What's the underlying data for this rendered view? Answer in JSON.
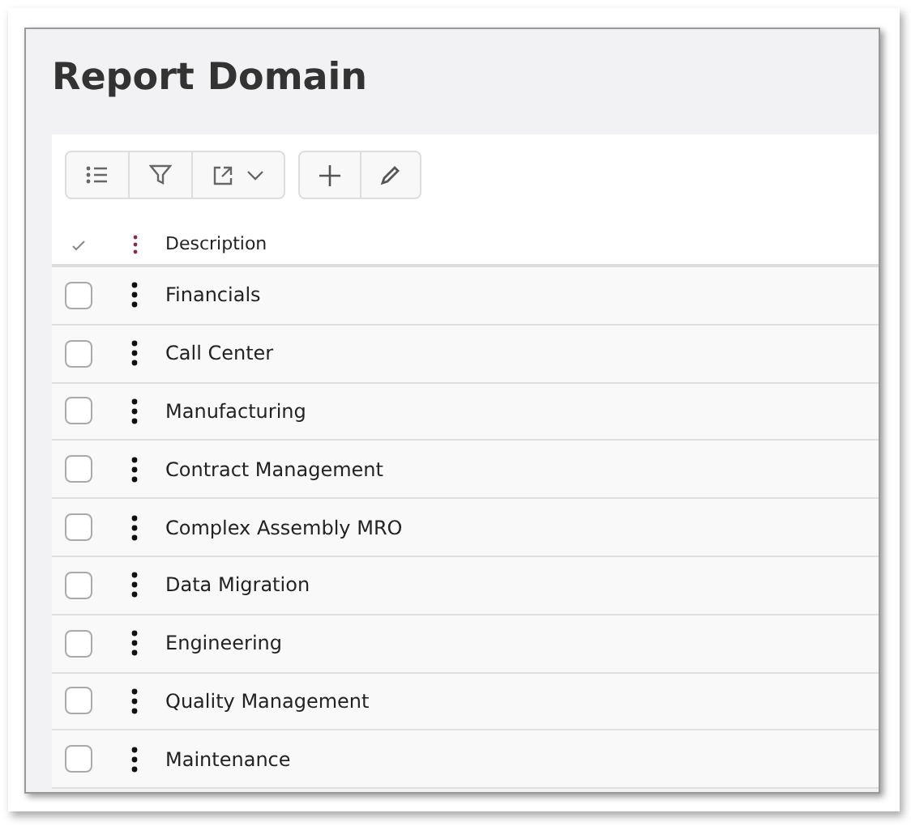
{
  "title": "Report Domain",
  "table": {
    "columns": [
      "Description"
    ],
    "rows": [
      {
        "description": "Financials",
        "checked": false
      },
      {
        "description": "Call Center",
        "checked": false
      },
      {
        "description": "Manufacturing",
        "checked": false
      },
      {
        "description": "Contract Management",
        "checked": false
      },
      {
        "description": "Complex Assembly MRO",
        "checked": false
      },
      {
        "description": "Data Migration",
        "checked": false
      },
      {
        "description": "Engineering",
        "checked": false
      },
      {
        "description": "Quality Management",
        "checked": false
      },
      {
        "description": "Maintenance",
        "checked": false
      }
    ]
  }
}
